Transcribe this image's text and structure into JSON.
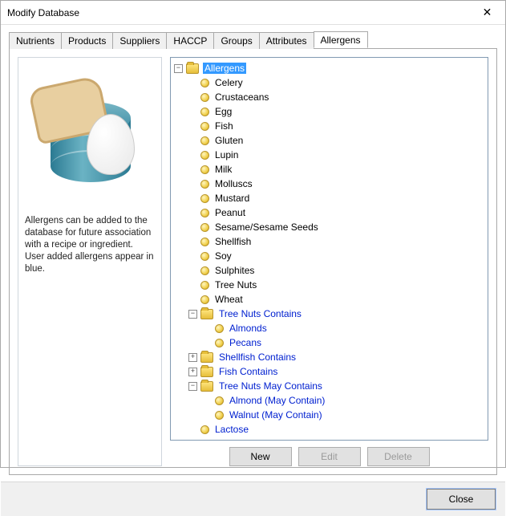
{
  "window": {
    "title": "Modify Database"
  },
  "tabs": [
    {
      "label": "Nutrients"
    },
    {
      "label": "Products"
    },
    {
      "label": "Suppliers"
    },
    {
      "label": "HACCP"
    },
    {
      "label": "Groups"
    },
    {
      "label": "Attributes"
    },
    {
      "label": "Allergens"
    }
  ],
  "help_text": "Allergens can be added to the database for future association with a recipe or ingredient.  User added allergens appear in blue.",
  "tree": {
    "root": {
      "label": "Allergens",
      "selected": true
    },
    "items": [
      {
        "label": "Celery"
      },
      {
        "label": "Crustaceans"
      },
      {
        "label": "Egg"
      },
      {
        "label": "Fish"
      },
      {
        "label": "Gluten"
      },
      {
        "label": "Lupin"
      },
      {
        "label": "Milk"
      },
      {
        "label": "Molluscs"
      },
      {
        "label": "Mustard"
      },
      {
        "label": "Peanut"
      },
      {
        "label": "Sesame/Sesame Seeds"
      },
      {
        "label": "Shellfish"
      },
      {
        "label": "Soy"
      },
      {
        "label": "Sulphites"
      },
      {
        "label": "Tree Nuts"
      },
      {
        "label": "Wheat"
      }
    ],
    "groups": [
      {
        "label": "Tree Nuts Contains",
        "expanded": true,
        "blue": true,
        "children": [
          {
            "label": "Almonds",
            "blue": true
          },
          {
            "label": "Pecans",
            "blue": true
          }
        ]
      },
      {
        "label": "Shellfish Contains",
        "expanded": false,
        "blue": true,
        "children": []
      },
      {
        "label": "Fish Contains",
        "expanded": false,
        "blue": true,
        "children": []
      },
      {
        "label": "Tree Nuts May Contains",
        "expanded": true,
        "blue": true,
        "children": [
          {
            "label": "Almond (May Contain)",
            "blue": true
          },
          {
            "label": "Walnut (May Contain)",
            "blue": true
          }
        ]
      }
    ],
    "extras": [
      {
        "label": "Lactose",
        "blue": true
      }
    ]
  },
  "buttons": {
    "new": "New",
    "edit": "Edit",
    "delete": "Delete",
    "close": "Close"
  }
}
